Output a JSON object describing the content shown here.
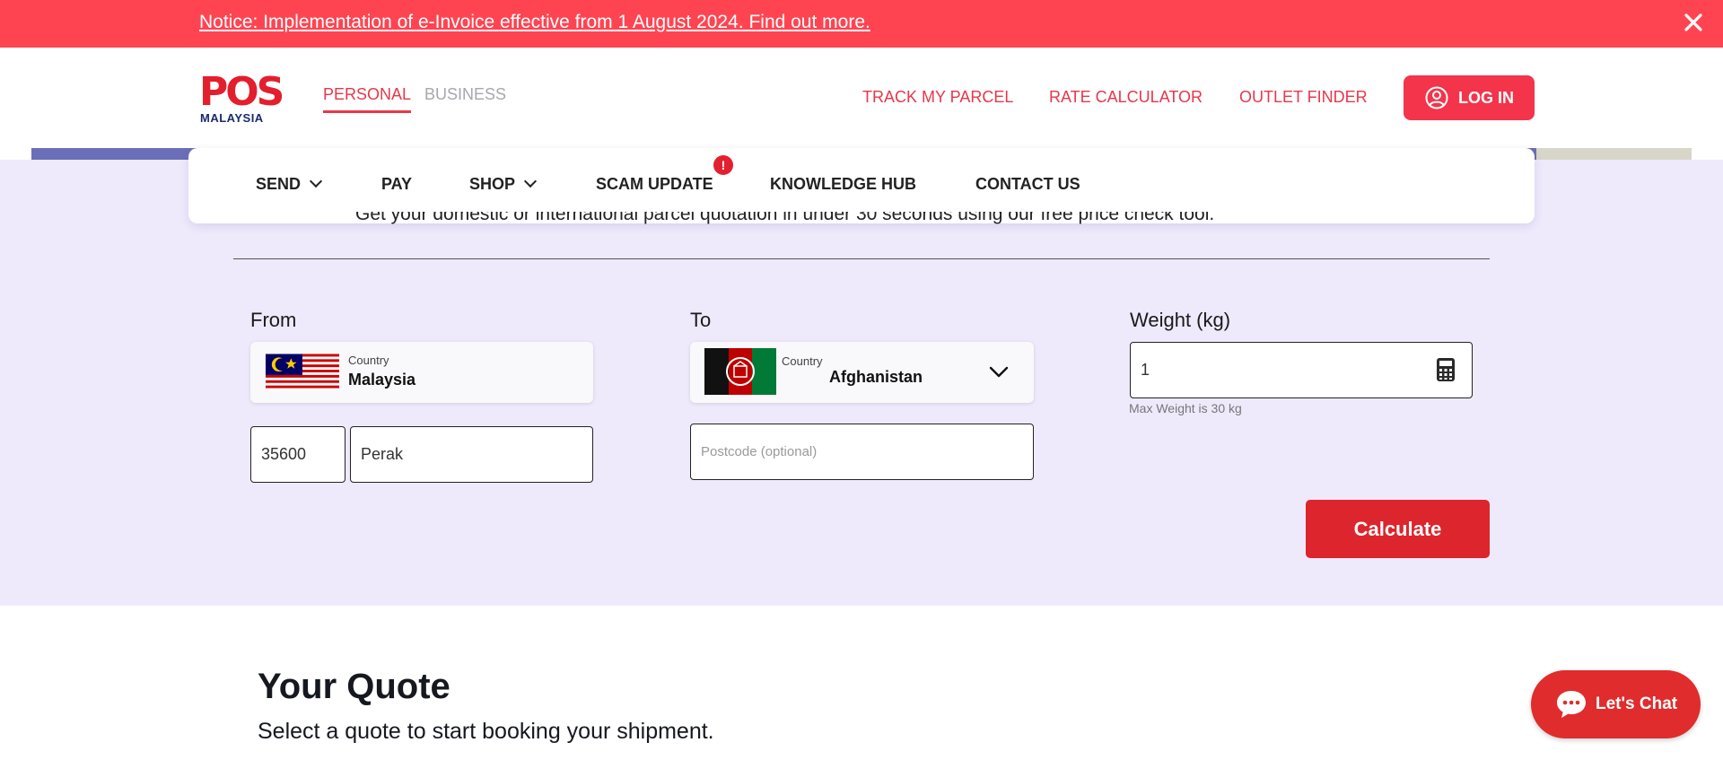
{
  "notice": {
    "text": "Notice: Implementation of e-Invoice effective from 1 August 2024. Find out more."
  },
  "header": {
    "logo_text": "POS",
    "logo_sub": "MALAYSIA",
    "segments": [
      "PERSONAL",
      "BUSINESS"
    ],
    "links": [
      "TRACK MY PARCEL",
      "RATE CALCULATOR",
      "OUTLET FINDER"
    ],
    "login_label": "LOG IN"
  },
  "menu": {
    "items": [
      "SEND",
      "PAY",
      "SHOP",
      "SCAM UPDATE",
      "KNOWLEDGE HUB",
      "CONTACT US"
    ],
    "badge": "!"
  },
  "calculator": {
    "subtitle": "Get your domestic or international parcel quotation in under 30 seconds using our free price check tool.",
    "from": {
      "label": "From",
      "country_small": "Country",
      "country": "Malaysia",
      "postcode": "35600",
      "state": "Perak"
    },
    "to": {
      "label": "To",
      "country_small": "Country",
      "country": "Afghanistan",
      "postcode_placeholder": "Postcode (optional)"
    },
    "weight": {
      "label": "Weight (kg)",
      "value": "1",
      "hint": "Max Weight is 30 kg"
    },
    "button": "Calculate"
  },
  "quote": {
    "title": "Your Quote",
    "subtitle": "Select a quote to start booking your shipment."
  },
  "chat": {
    "label": "Let's Chat"
  },
  "colors": {
    "notice_bg": "#ff4451",
    "accent": "#e8374a",
    "lavender": "#efe9fc",
    "calc_button": "#dd252d",
    "chat_button": "#e02c2c"
  },
  "icons": [
    "close-icon",
    "user-icon",
    "chevron-down-icon",
    "calculator-icon",
    "chat-bubble-icon",
    "malaysia-flag-icon",
    "afghanistan-flag-icon"
  ]
}
